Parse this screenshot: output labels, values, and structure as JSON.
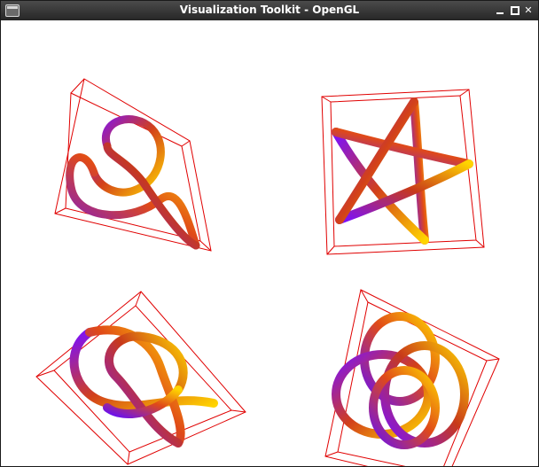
{
  "window": {
    "title": "Visualization Toolkit - OpenGL",
    "icon": "window-icon",
    "controls": [
      "minimize-icon",
      "maximize-icon",
      "close-icon"
    ]
  },
  "viewport": {
    "background": "#ffffff",
    "outline_color": "#e00000",
    "tube_colors": [
      "#7a10ff",
      "#e0401a",
      "#ffd400"
    ],
    "views": [
      {
        "name": "knot-view-top-left",
        "content": "trefoil knot tube"
      },
      {
        "name": "knot-view-top-right",
        "content": "pentagram star knot tube"
      },
      {
        "name": "knot-view-bottom-left",
        "content": "figure-eight knot tube"
      },
      {
        "name": "knot-view-bottom-right",
        "content": "torus knot tube"
      }
    ]
  }
}
